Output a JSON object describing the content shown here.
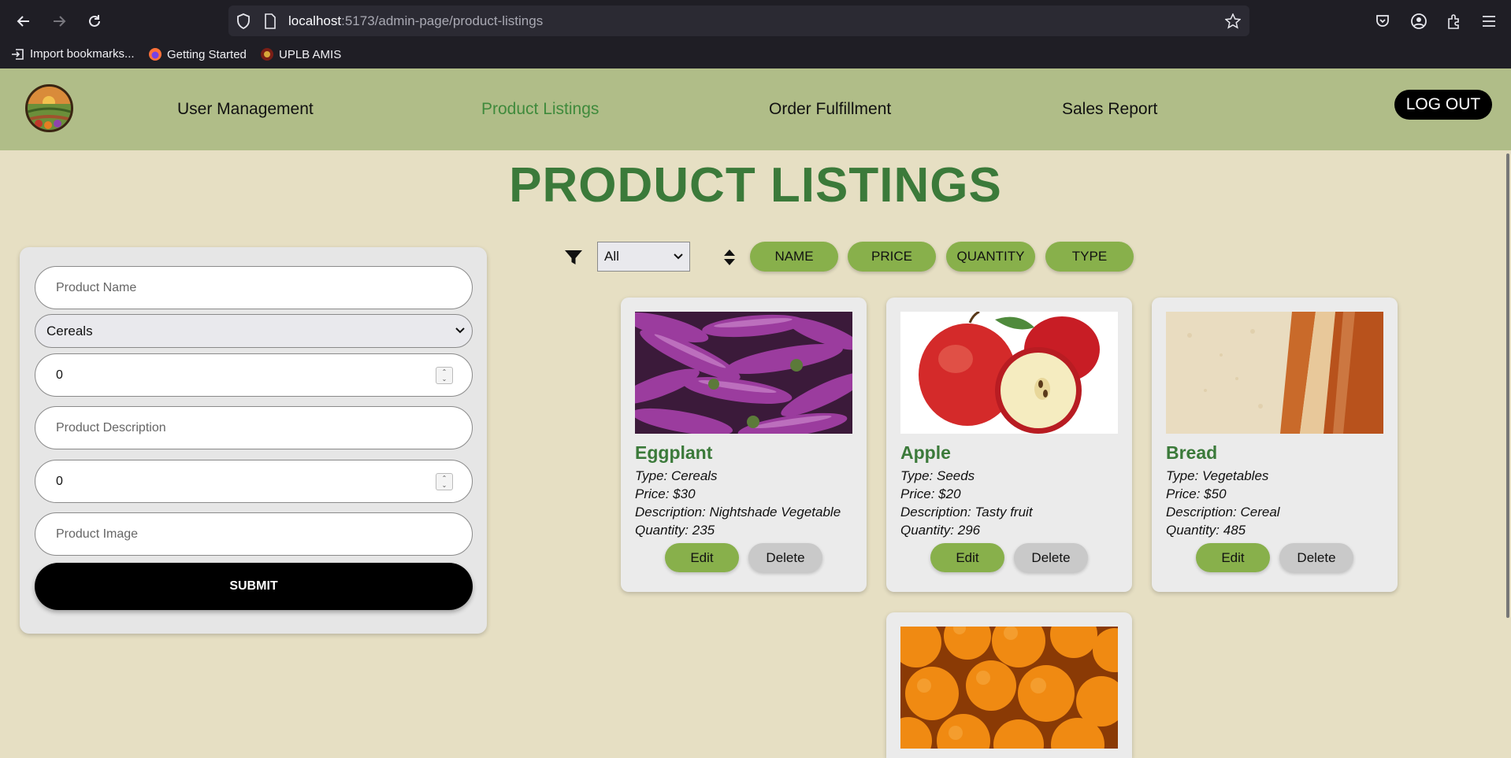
{
  "browser": {
    "url_host": "localhost",
    "url_path": ":5173/admin-page/product-listings",
    "bookmarks": [
      {
        "label": "Import bookmarks..."
      },
      {
        "label": "Getting Started"
      },
      {
        "label": "UPLB AMIS"
      }
    ]
  },
  "nav": {
    "links": [
      {
        "label": "User Management"
      },
      {
        "label": "Product Listings"
      },
      {
        "label": "Order Fulfillment"
      },
      {
        "label": "Sales Report"
      }
    ],
    "logout_label": "LOG OUT"
  },
  "page_title": "PRODUCT LISTINGS",
  "form": {
    "name_placeholder": "Product Name",
    "type_value": "Cereals",
    "price_value": "0",
    "description_placeholder": "Product Description",
    "quantity_value": "0",
    "image_placeholder": "Product Image",
    "submit_label": "SUBMIT"
  },
  "toolbar": {
    "filter_value": "All",
    "sort_buttons": [
      {
        "label": "NAME"
      },
      {
        "label": "PRICE"
      },
      {
        "label": "QUANTITY"
      },
      {
        "label": "TYPE"
      }
    ]
  },
  "products": [
    {
      "name": "Eggplant",
      "type": "Type: Cereals",
      "price": "Price: $30",
      "description": "Description: Nightshade Vegetable",
      "quantity": "Quantity: 235",
      "edit": "Edit",
      "delete": "Delete"
    },
    {
      "name": "Apple",
      "type": "Type: Seeds",
      "price": "Price: $20",
      "description": "Description: Tasty fruit",
      "quantity": "Quantity: 296",
      "edit": "Edit",
      "delete": "Delete"
    },
    {
      "name": "Bread",
      "type": "Type: Vegetables",
      "price": "Price: $50",
      "description": "Description: Cereal",
      "quantity": "Quantity: 485",
      "edit": "Edit",
      "delete": "Delete"
    }
  ],
  "colors": {
    "background": "#e6dfc3",
    "header": "#b0bd88",
    "accent_green": "#88b04b",
    "title_green": "#3b7a3a"
  }
}
